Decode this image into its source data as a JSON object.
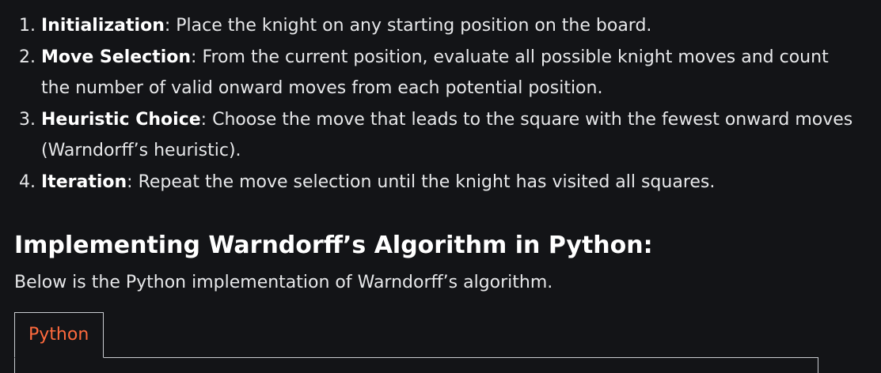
{
  "steps": [
    {
      "number": "1.",
      "term": "Initialization",
      "sep": ":",
      "text": " Place the knight on any starting position on the board."
    },
    {
      "number": "2.",
      "term": "Move Selection",
      "sep": ":",
      "text": " From the current position, evaluate all possible knight moves and count the number of valid onward moves from each potential position."
    },
    {
      "number": "3.",
      "term": "Heuristic Choice",
      "sep": ":",
      "text": " Choose the move that leads to the square with the fewest onward moves (Warndorff’s heuristic)."
    },
    {
      "number": "4.",
      "term": "Iteration",
      "sep": ":",
      "text": " Repeat the move selection until the knight has visited all squares."
    }
  ],
  "section": {
    "title": "Implementing Warndorff’s Algorithm in Python:",
    "intro": "Below is the Python implementation of Warndorff’s algorithm."
  },
  "code_tabs": {
    "active_label": "Python"
  },
  "colors": {
    "background": "#131417",
    "text": "#e7e8ea",
    "tab_accent": "#ff6a3d",
    "border": "#c9ccd1"
  }
}
